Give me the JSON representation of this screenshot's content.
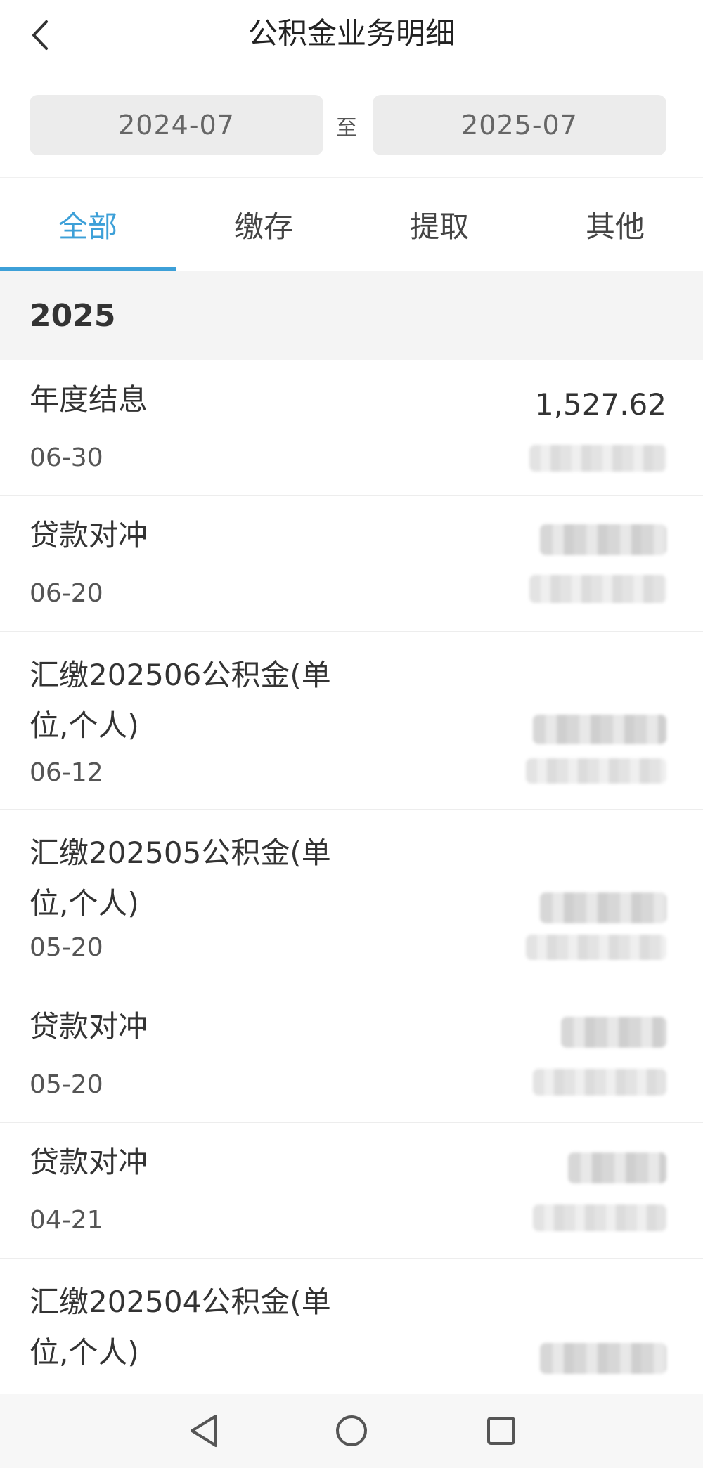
{
  "header": {
    "title": "公积金业务明细",
    "back_icon": "chevron-left-icon"
  },
  "date_range": {
    "start": "2024-07",
    "separator": "至",
    "end": "2025-07"
  },
  "tabs": [
    {
      "label": "全部",
      "active": true
    },
    {
      "label": "缴存",
      "active": false
    },
    {
      "label": "提取",
      "active": false
    },
    {
      "label": "其他",
      "active": false
    }
  ],
  "year": "2025",
  "transactions": [
    {
      "title": "年度结息",
      "date": "06-30",
      "amount": "1,527.62"
    },
    {
      "title": "贷款对冲",
      "date": "06-20"
    },
    {
      "title": "汇缴202506公积金(单位,个人)",
      "date": "06-12"
    },
    {
      "title": "汇缴202505公积金(单位,个人)",
      "date": "05-20"
    },
    {
      "title": "贷款对冲",
      "date": "05-20"
    },
    {
      "title": "贷款对冲",
      "date": "04-21"
    },
    {
      "title": "汇缴202504公积金(单位,个人)"
    }
  ],
  "colors": {
    "accent": "#3da0d8",
    "section_bg": "#f4f4f4",
    "pill_bg": "#ececec"
  },
  "navbar": {
    "icons": [
      "triangle-back-icon",
      "circle-home-icon",
      "square-recent-icon"
    ]
  }
}
